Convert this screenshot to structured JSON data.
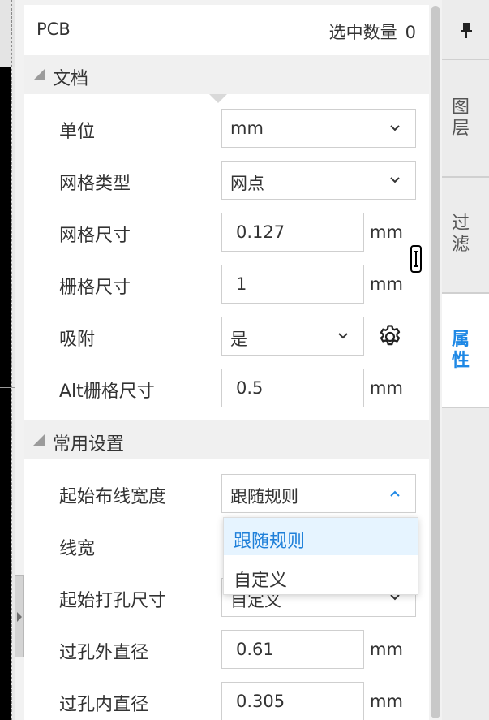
{
  "panel": {
    "title": "PCB",
    "selection_label": "选中数量",
    "selection_count": "0"
  },
  "sections": {
    "document": {
      "title": "文档",
      "rows": {
        "unit": {
          "label": "单位",
          "value": "mm"
        },
        "grid_type": {
          "label": "网格类型",
          "value": "网点"
        },
        "grid_size": {
          "label": "网格尺寸",
          "value": "0.127",
          "unit": "mm"
        },
        "snap_size": {
          "label": "栅格尺寸",
          "value": "1",
          "unit": "mm"
        },
        "snap": {
          "label": "吸附",
          "value": "是"
        },
        "alt_snap_size": {
          "label": "Alt栅格尺寸",
          "value": "0.5",
          "unit": "mm"
        }
      }
    },
    "common": {
      "title": "常用设置",
      "rows": {
        "start_track_width": {
          "label": "起始布线宽度",
          "value": "跟随规则"
        },
        "line_width": {
          "label": "线宽"
        },
        "start_drill_size": {
          "label": "起始打孔尺寸",
          "value": "自定义"
        },
        "via_outer_diameter": {
          "label": "过孔外直径",
          "value": "0.61",
          "unit": "mm"
        },
        "via_inner_diameter": {
          "label": "过孔内直径",
          "value": "0.305",
          "unit": "mm"
        }
      }
    }
  },
  "dropdown": {
    "options": [
      {
        "label": "跟随规则",
        "selected": true
      },
      {
        "label": "自定义",
        "selected": false
      }
    ]
  },
  "right_tabs": {
    "pin_icon": "pin-icon",
    "tabs": [
      {
        "label": "图层",
        "active": false
      },
      {
        "label": "过滤",
        "active": false
      },
      {
        "label": "属性",
        "active": true
      }
    ]
  },
  "colors": {
    "accent": "#1e88e5",
    "selected_bg": "#e6f4ff",
    "section_bg": "#f0f0f0",
    "panel_bg": "#ffffff",
    "border": "#cfcfcf"
  },
  "icons": {
    "chevron": "chevron-down-icon",
    "chevron_up": "chevron-up-icon",
    "gear": "gear-icon",
    "collapse": "collapse-arrow-icon",
    "resize": "resize-cursor-icon"
  }
}
